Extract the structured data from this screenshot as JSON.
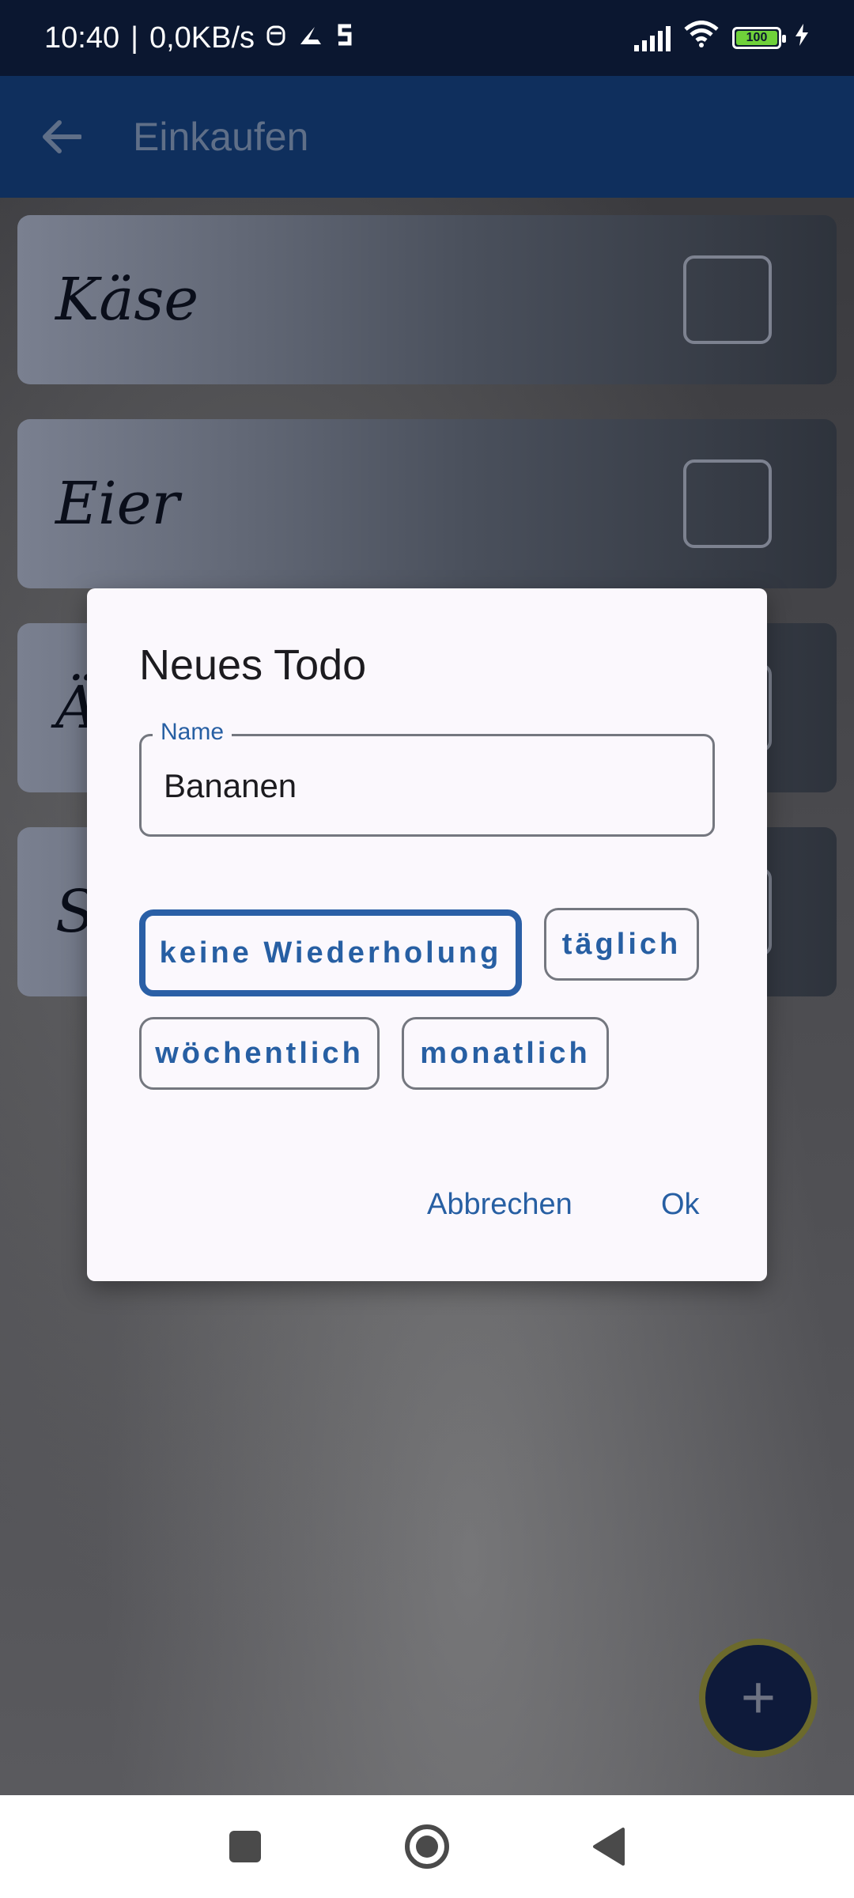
{
  "status_bar": {
    "time": "10:40",
    "separator": "|",
    "network_speed": "0,0KB/s",
    "app_icons": [
      "notification-icon",
      "vpn-icon",
      "s-app-icon"
    ],
    "battery_level": "100",
    "charging": true
  },
  "app_bar": {
    "back_icon": "arrow-left-icon",
    "title": "Einkaufen"
  },
  "todo_items": [
    {
      "label": "Käse",
      "checked": false
    },
    {
      "label": "Eier",
      "checked": false
    },
    {
      "label": "Ä",
      "checked": false
    },
    {
      "label": "S",
      "checked": false
    }
  ],
  "dialog": {
    "title": "Neues Todo",
    "name_field": {
      "label": "Name",
      "value": "Bananen"
    },
    "repeat_options": [
      {
        "label": "keine Wiederholung",
        "selected": true
      },
      {
        "label": "täglich",
        "selected": false
      },
      {
        "label": "wöchentlich",
        "selected": false
      },
      {
        "label": "monatlich",
        "selected": false
      }
    ],
    "cancel_label": "Abbrechen",
    "ok_label": "Ok"
  },
  "fab": {
    "icon": "plus-icon",
    "label": "+"
  },
  "nav_bar": {
    "icons": [
      "square-recents-icon",
      "circle-home-icon",
      "triangle-back-icon"
    ]
  },
  "colors": {
    "app_bar": "#0f2f5d",
    "accent": "#275fa3",
    "dialog_bg": "#fbf8fd"
  }
}
